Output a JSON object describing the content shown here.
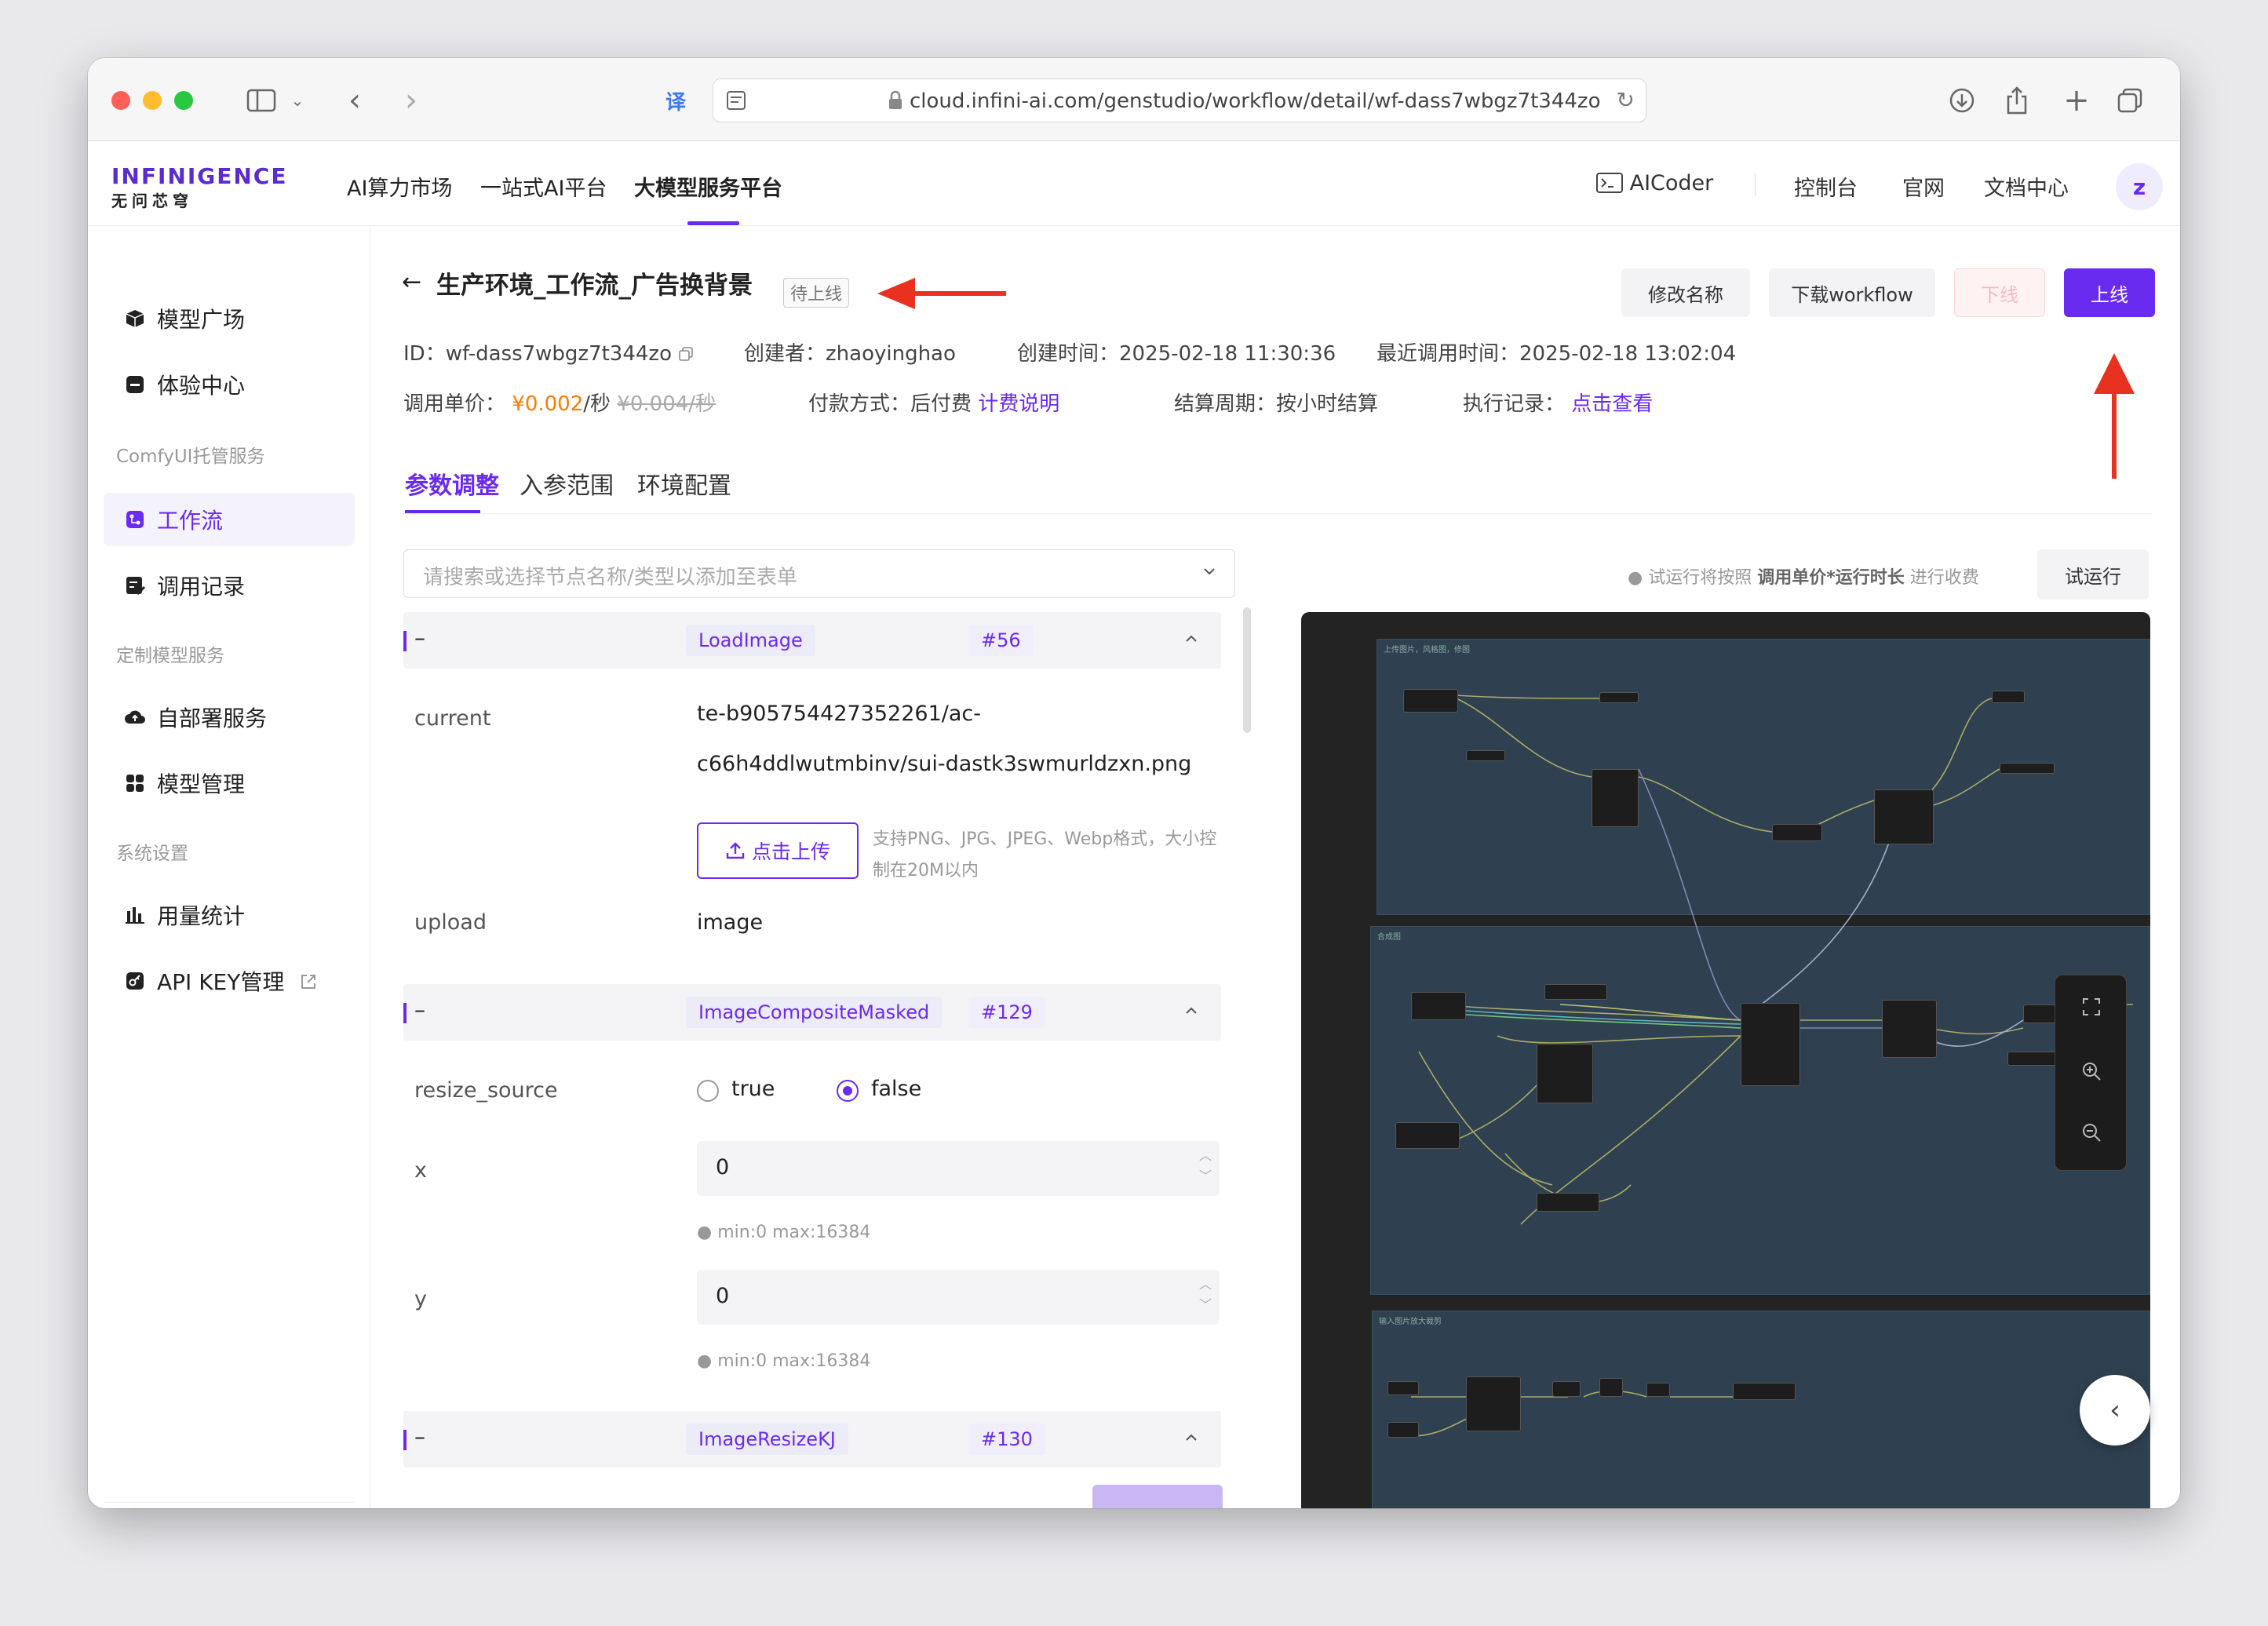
{
  "browser": {
    "url": "cloud.infini-ai.com/genstudio/workflow/detail/wf-dass7wbgz7t344zo"
  },
  "header": {
    "logo_top": "INFINIGENCE",
    "logo_bottom": "无问芯穹",
    "nav": [
      "AI算力市场",
      "一站式AI平台",
      "大模型服务平台"
    ],
    "right": [
      "AICoder",
      "控制台",
      "官网",
      "文档中心"
    ],
    "avatar": "z"
  },
  "sidebar": {
    "item_model_plaza": "模型广场",
    "item_experience": "体验中心",
    "group_comfy": "ComfyUI托管服务",
    "item_workflow": "工作流",
    "item_call_records": "调用记录",
    "group_custom": "定制模型服务",
    "item_self_deploy": "自部署服务",
    "item_model_mgmt": "模型管理",
    "group_system": "系统设置",
    "item_usage": "用量统计",
    "item_apikey": "API KEY管理"
  },
  "page": {
    "title": "生产环境_工作流_广告换背景",
    "status": "待上线",
    "btn_rename": "修改名称",
    "btn_download": "下载workflow",
    "btn_offline": "下线",
    "btn_online": "上线",
    "id_label": "ID：",
    "id_value": "wf-dass7wbgz7t344zo",
    "creator_label": "创建者：",
    "creator_value": "zhaoyinghao",
    "created_label": "创建时间：",
    "created_value": "2025-02-18 11:30:36",
    "last_call_label": "最近调用时间：",
    "last_call_value": "2025-02-18 13:02:04",
    "unit_label": "调用单价：",
    "unit_prefix": "¥",
    "unit_price": "0.002",
    "unit_suffix": "/秒",
    "unit_old": "¥0.004/秒",
    "pay_label": "付款方式：",
    "pay_value": "后付费",
    "pay_link": "计费说明",
    "cycle_label": "结算周期：",
    "cycle_value": "按小时结算",
    "exec_label": "执行记录：",
    "exec_link": "点击查看"
  },
  "tabs": [
    "参数调整",
    "入参范围",
    "环境配置"
  ],
  "form": {
    "node_select_placeholder": "请搜索或选择节点名称/类型以添加至表单",
    "sections": [
      {
        "dash": "–",
        "type": "LoadImage",
        "id": "#56"
      },
      {
        "dash": "–",
        "type": "ImageCompositeMasked",
        "id": "#129"
      },
      {
        "dash": "–",
        "type": "ImageResizeKJ",
        "id": "#130"
      }
    ],
    "current_label": "current",
    "current_line1": "te-b905754427352261/ac-",
    "current_line2": "c66h4ddlwutmbinv/sui-dastk3swmurldzxn.png",
    "upload_button": "点击上传",
    "upload_hint": "支持PNG、JPG、JPEG、Webp格式，大小控制在20M以内",
    "upload_label": "upload",
    "upload_value": "image",
    "resize_label": "resize_source",
    "radio_true": "true",
    "radio_false": "false",
    "x_label": "x",
    "x_value": "0",
    "y_label": "y",
    "y_value": "0",
    "minmax": "min:0  max:16384"
  },
  "trial": {
    "note_prefix": "试运行将按照",
    "note_bold": "调用单价*运行时长",
    "note_suffix": "进行收费",
    "button": "试运行"
  },
  "canvas": {
    "group1_label": "上传图片，风格图，修图",
    "group2_label": "合成图",
    "group3_label": "输入图片放大裁剪"
  },
  "colors": {
    "accent": "#6a2bf0",
    "price": "#ff7a00",
    "annotation_arrow": "#e8321f"
  }
}
